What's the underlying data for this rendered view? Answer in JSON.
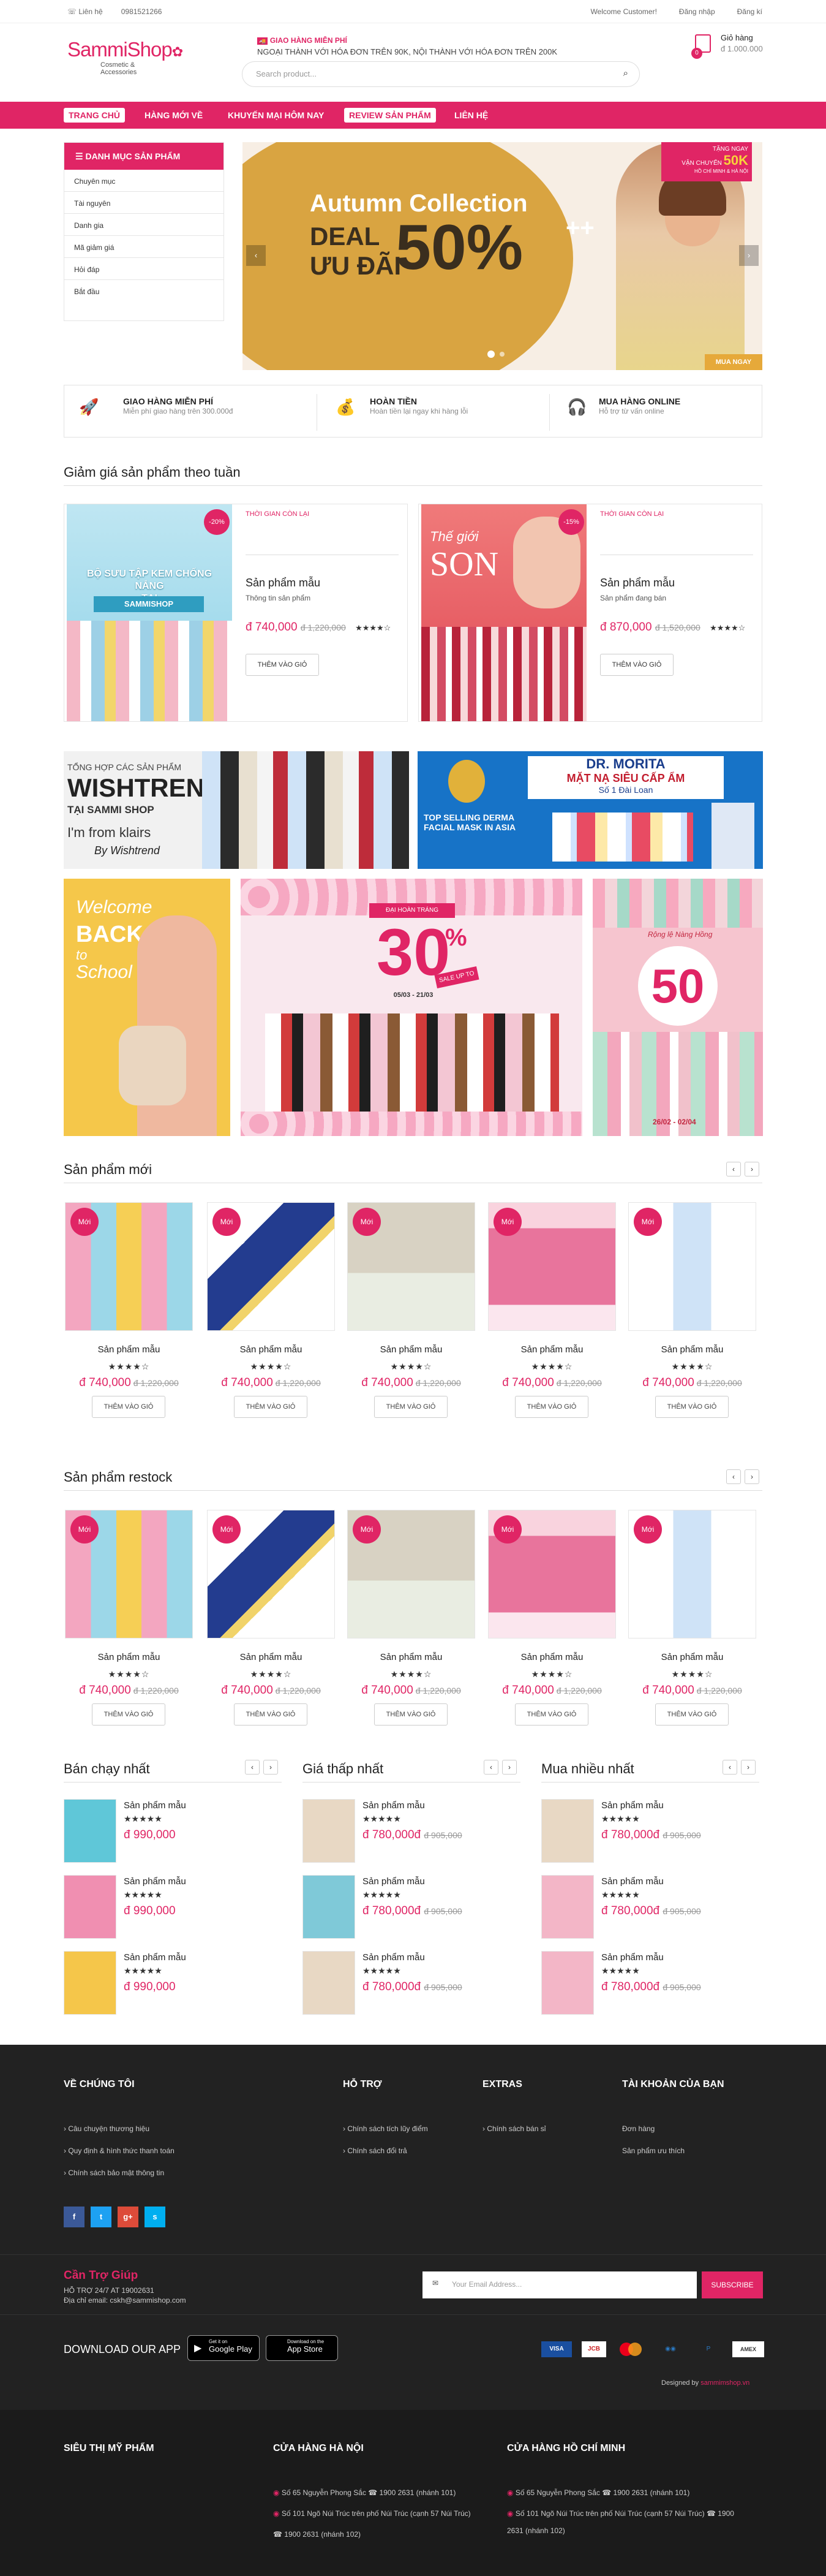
{
  "topbar": {
    "contact": "Liên hệ",
    "phone": "0981521266",
    "welcome": "Welcome Customer!",
    "login": "Đăng nhập",
    "register": "Đăng kí"
  },
  "brand": {
    "name": "SammiShop",
    "tagline": "Cosmetic & Accessories"
  },
  "shipping": {
    "title": "GIAO HÀNG MIỄN PHÍ",
    "desc": "NGOẠI THÀNH VỚI HÓA ĐƠN TRÊN 90K, NỘI THÀNH VỚI HÓA ĐƠN TRÊN 200K"
  },
  "search": {
    "placeholder": "Search product..."
  },
  "cart": {
    "label": "Giỏ hàng",
    "total": "đ 1.000.000",
    "count": "0"
  },
  "nav": [
    "TRANG CHỦ",
    "HÀNG MỚI VỀ",
    "KHUYẾN MẠI HÔM NAY",
    "REVIEW SẢN PHẨM",
    "LIÊN HỆ"
  ],
  "categories": {
    "title": "DANH MỤC SẢN PHẨM",
    "items": [
      "Chuyên mục",
      "Tài nguyên",
      "Danh gia",
      "Mã giảm giá",
      "Hỏi đáp",
      "Bắt đầu"
    ]
  },
  "slider": {
    "line1": "Autumn Collection",
    "deal": "DEAL",
    "discount": "ƯU ĐÃI",
    "percent": "50%",
    "plus": "++",
    "promo1": "TẶNG NGAY",
    "promo2": "VẬN CHUYỂN",
    "promo3": "50K",
    "promo4": "HỒ CHÍ MINH & HÀ NỘI",
    "buy": "MUA NGAY"
  },
  "features": [
    {
      "title": "GIAO HÀNG MIỄN PHÍ",
      "desc": "Miễn phí giao hàng trên 300.000đ"
    },
    {
      "title": "HOÀN TIỀN",
      "desc": "Hoàn tiền lại ngay khi hàng lỗi"
    },
    {
      "title": "MUA HÀNG ONLINE",
      "desc": "Hỗ trợ từ vấn online"
    }
  ],
  "weekly": {
    "title": "Giảm giá sản phẩm theo tuần",
    "time_label": "THỜI GIAN CÒN LẠI",
    "items": [
      {
        "badge": "-20%",
        "name": "Sản phẩm mẫu",
        "desc": "Thông tin sản phẩm",
        "price": "đ 740,000",
        "old": "đ 1,220,000",
        "stars": "★★★★☆",
        "btn": "THÊM VÀO GIỎ",
        "img_text1": "BỘ SƯU TẬP KEM CHỐNG NẮNG",
        "img_text2": "TẠI",
        "img_text3": "SAMMISHOP"
      },
      {
        "badge": "-15%",
        "name": "Sản phẩm mẫu",
        "desc": "Sản phẩm đang bán",
        "price": "đ 870,000",
        "old": "đ 1,520,000",
        "stars": "★★★★☆",
        "btn": "THÊM VÀO GIỎ",
        "img_text1": "Thế giới",
        "img_text2": "SON"
      }
    ]
  },
  "banners": {
    "b1_l1": "TỔNG HỢP CÁC SẢN PHẨM",
    "b1_l2": "WISHTREND",
    "b1_l3": "TẠI SAMMI SHOP",
    "b1_l4": "I'm from klairs",
    "b1_l5": "By Wishtrend",
    "b2_l1": "DR. MORITA",
    "b2_l2": "MẶT NẠ SIÊU CẤP ẨM",
    "b2_l3": "Số 1 Đài Loan",
    "b2_l4": "TOP SELLING DERMA FACIAL MASK IN ASIA",
    "b3_l1": "Welcome",
    "b3_l2": "BACK",
    "b3_l3": "to",
    "b3_l4": "School",
    "b4_l1": "ĐẠI HOÀN TRÁNG",
    "b4_l2": "30",
    "b4_l3": "%",
    "b4_l4": "SALE UP TO",
    "b4_l5": "05/03 - 21/03",
    "b5_l1": "Rộng lệ Nàng Hồng",
    "b5_l2": "50",
    "b5_l3": "26/02 - 02/04"
  },
  "new": {
    "title": "Sản phẩm mới",
    "badge": "Mới",
    "name": "Sản phẩm mẫu",
    "stars": "★★★★☆",
    "price": "đ 740,000",
    "old": "đ 1,220,000",
    "btn": "THÊM VÀO GIỎ"
  },
  "restock": {
    "title": "Sản phẩm restock",
    "badge": "Mới",
    "name": "Sản phẩm mẫu",
    "stars": "★★★★☆",
    "price": "đ 740,000",
    "old": "đ 1,220,000",
    "btn": "THÊM VÀO GIỎ"
  },
  "lists": [
    {
      "title": "Bán chạy nhất",
      "items": [
        {
          "name": "Sản phẩm mẫu",
          "stars": "★★★★★",
          "price": "đ 990,000",
          "old": ""
        },
        {
          "name": "Sản phẩm mẫu",
          "stars": "★★★★★",
          "price": "đ 990,000",
          "old": ""
        },
        {
          "name": "Sản phẩm mẫu",
          "stars": "★★★★★",
          "price": "đ 990,000",
          "old": ""
        }
      ]
    },
    {
      "title": "Giá thấp nhất",
      "items": [
        {
          "name": "Sản phẩm mẫu",
          "stars": "★★★★★",
          "price": "đ 780,000đ",
          "old": "đ 905,000"
        },
        {
          "name": "Sản phẩm mẫu",
          "stars": "★★★★★",
          "price": "đ 780,000đ",
          "old": "đ 905,000"
        },
        {
          "name": "Sản phẩm mẫu",
          "stars": "★★★★★",
          "price": "đ 780,000đ",
          "old": "đ 905,000"
        }
      ]
    },
    {
      "title": "Mua nhiều nhất",
      "items": [
        {
          "name": "Sản phẩm mẫu",
          "stars": "★★★★★",
          "price": "đ 780,000đ",
          "old": "đ 905,000"
        },
        {
          "name": "Sản phẩm mẫu",
          "stars": "★★★★★",
          "price": "đ 780,000đ",
          "old": "đ 905,000"
        },
        {
          "name": "Sản phẩm mẫu",
          "stars": "★★★★★",
          "price": "đ 780,000đ",
          "old": "đ 905,000"
        }
      ]
    }
  ],
  "footer": {
    "about": {
      "title": "VỀ CHÚNG TÔI",
      "items": [
        "Câu chuyện thương hiệu",
        "Quy định & hình thức thanh toán",
        "Chính sách bảo mật thông tin"
      ]
    },
    "support": {
      "title": "HỖ TRỢ",
      "items": [
        "Chính sách tích lũy điểm",
        "Chính sách đổi trả"
      ]
    },
    "extras": {
      "title": "EXTRAS",
      "items": [
        "Chính sách bán sỉ"
      ]
    },
    "account": {
      "title": "TÀI KHOẢN CỦA BẠN",
      "items": [
        "Đơn hàng",
        "Sản phẩm ưu thích"
      ]
    },
    "help": {
      "title": "Cần Trợ Giúp",
      "hotline": "HỖ TRỢ 24/7 AT 19002631",
      "email": "Địa chỉ email: cskh@sammishop.com"
    },
    "newsletter": {
      "placeholder": "Your Email Address...",
      "btn": "SUBSCRIBE"
    },
    "app": {
      "title": "DOWNLOAD OUR APP",
      "google_small": "Get it on",
      "google": "Google Play",
      "apple_small": "Download on the",
      "apple": "App Store"
    },
    "designed": "Designed by",
    "designer": "sammimshop.vn",
    "cosmetics": {
      "title": "SIÊU THỊ MỸ PHẨM"
    },
    "hanoi": {
      "title": "CỬA HÀNG HÀ NỘI",
      "items": [
        "Số 65 Nguyễn Phong Sắc ☎ 1900 2631 (nhánh 101)",
        "Số 101 Ngõ Núi Trúc trên phố Núi Trúc (cạnh 57 Núi Trúc)",
        "☎ 1900 2631 (nhánh 102)"
      ]
    },
    "hcm": {
      "title": "CỬA HÀNG HỒ CHÍ MINH",
      "items": [
        "Số 65 Nguyễn Phong Sắc ☎ 1900 2631 (nhánh 101)",
        "Số 101 Ngõ Núi Trúc trên phố Núi Trúc (cạnh 57 Núi Trúc) ☎ 1900",
        "2631 (nhánh 102)"
      ]
    }
  },
  "colors": {
    "primary": "#e02565",
    "footer": "#222222"
  }
}
